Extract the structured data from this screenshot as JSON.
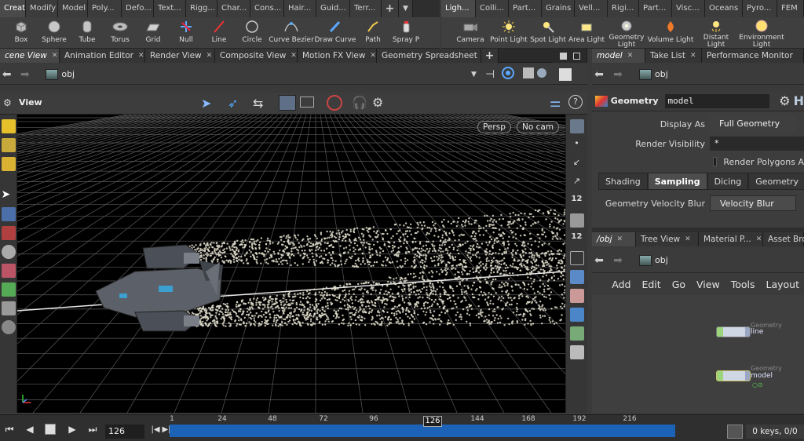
{
  "shelf_tabs_left": [
    "Create",
    "Modify",
    "Model",
    "Poly...",
    "Defo...",
    "Text...",
    "Rigg...",
    "Char...",
    "Cons...",
    "Hair...",
    "Guid...",
    "Terr..."
  ],
  "shelf_tabs_right": [
    "Ligh...",
    "Colli...",
    "Part...",
    "Grains",
    "Vell...",
    "Rigi...",
    "Part...",
    "Visc...",
    "Oceans",
    "Pyro...",
    "FEM"
  ],
  "shelf_tools_left": [
    "Box",
    "Sphere",
    "Tube",
    "Torus",
    "Grid",
    "Null",
    "Line",
    "Circle",
    "Curve Bezier",
    "Draw Curve",
    "Path",
    "Spray P"
  ],
  "shelf_tools_right": [
    "Camera",
    "Point Light",
    "Spot Light",
    "Area Light",
    "Geometry Light",
    "Volume Light",
    "Distant Light",
    "Environment Light"
  ],
  "viewer_tabs": [
    "cene View",
    "Animation Editor",
    "Render View",
    "Composite View",
    "Motion FX View",
    "Geometry Spreadsheet"
  ],
  "right_top_tabs": [
    "model",
    "Take List",
    "Performance Monitor"
  ],
  "right_bottom_tabs": [
    "/obj",
    "Tree View",
    "Material P...",
    "Asset Bro..."
  ],
  "viewer_path": "obj",
  "param_path": "obj",
  "network_path": "obj",
  "viewer_title": "View",
  "viewport": {
    "camera_mode": "Persp",
    "camera": "No cam"
  },
  "params": {
    "node_type": "Geometry",
    "node_name": "model",
    "display_as_label": "Display As",
    "display_as_value": "Full Geometry",
    "render_visibility_label": "Render Visibility",
    "render_visibility_value": "*",
    "render_polygons_label": "Render Polygons A",
    "subtabs": [
      "Shading",
      "Sampling",
      "Dicing",
      "Geometry"
    ],
    "velocity_blur_label": "Geometry Velocity Blur",
    "velocity_blur_value": "Velocity Blur"
  },
  "network_menu": [
    "Add",
    "Edit",
    "Go",
    "View",
    "Tools",
    "Layout"
  ],
  "network_nodes": [
    {
      "name": "line",
      "sub": "Geometry"
    },
    {
      "name": "model",
      "sub": "Geometry"
    }
  ],
  "timeline": {
    "current_frame": "126",
    "current_frame_marker": "126",
    "ticks": [
      "1",
      "24",
      "48",
      "72",
      "96",
      "144",
      "168",
      "192",
      "216"
    ],
    "keys_status": "0 keys, 0/0"
  },
  "colors": {
    "timeline_track": "#1c63b8",
    "particles": "#e4e1cf",
    "selected_tab": "#474747"
  }
}
